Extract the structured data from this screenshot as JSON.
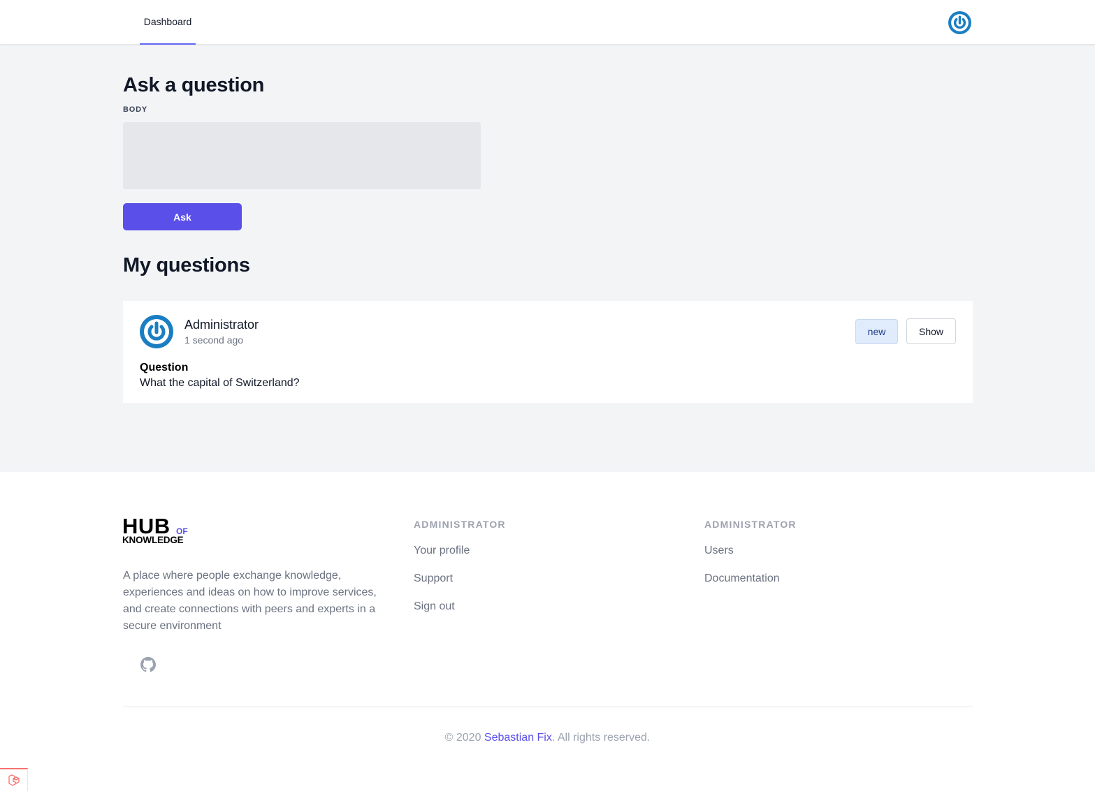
{
  "nav": {
    "dashboard_label": "Dashboard",
    "avatar_icon": "power-icon"
  },
  "ask": {
    "title": "Ask a question",
    "body_label": "BODY",
    "body_value": "",
    "ask_label": "Ask"
  },
  "my_questions": {
    "title": "My questions",
    "items": [
      {
        "author": "Administrator",
        "time": "1 second ago",
        "status": "new",
        "show_label": "Show",
        "question_label": "Question",
        "question_text": "What the capital of Switzerland?"
      }
    ]
  },
  "footer": {
    "logo": {
      "hub": "HUB",
      "of": "OF",
      "knowledge": "KNOWLEDGE"
    },
    "description": "A place where people exchange knowledge, experiences and ideas on how to improve services, and create connections with peers and experts in a secure environment",
    "github_icon": "github-icon",
    "columns": [
      {
        "heading": "ADMINISTRATOR",
        "links": [
          "Your profile",
          "Support",
          "Sign out"
        ]
      },
      {
        "heading": "ADMINISTRATOR",
        "links": [
          "Users",
          "Documentation"
        ]
      }
    ],
    "copyright_prefix": "© 2020 ",
    "copyright_author": "Sebastian Fix",
    "copyright_suffix": ". All rights reserved."
  },
  "colors": {
    "accent": "#5a4fe9",
    "avatar_blue": "#1b7ec2",
    "background": "#f3f4f6"
  }
}
